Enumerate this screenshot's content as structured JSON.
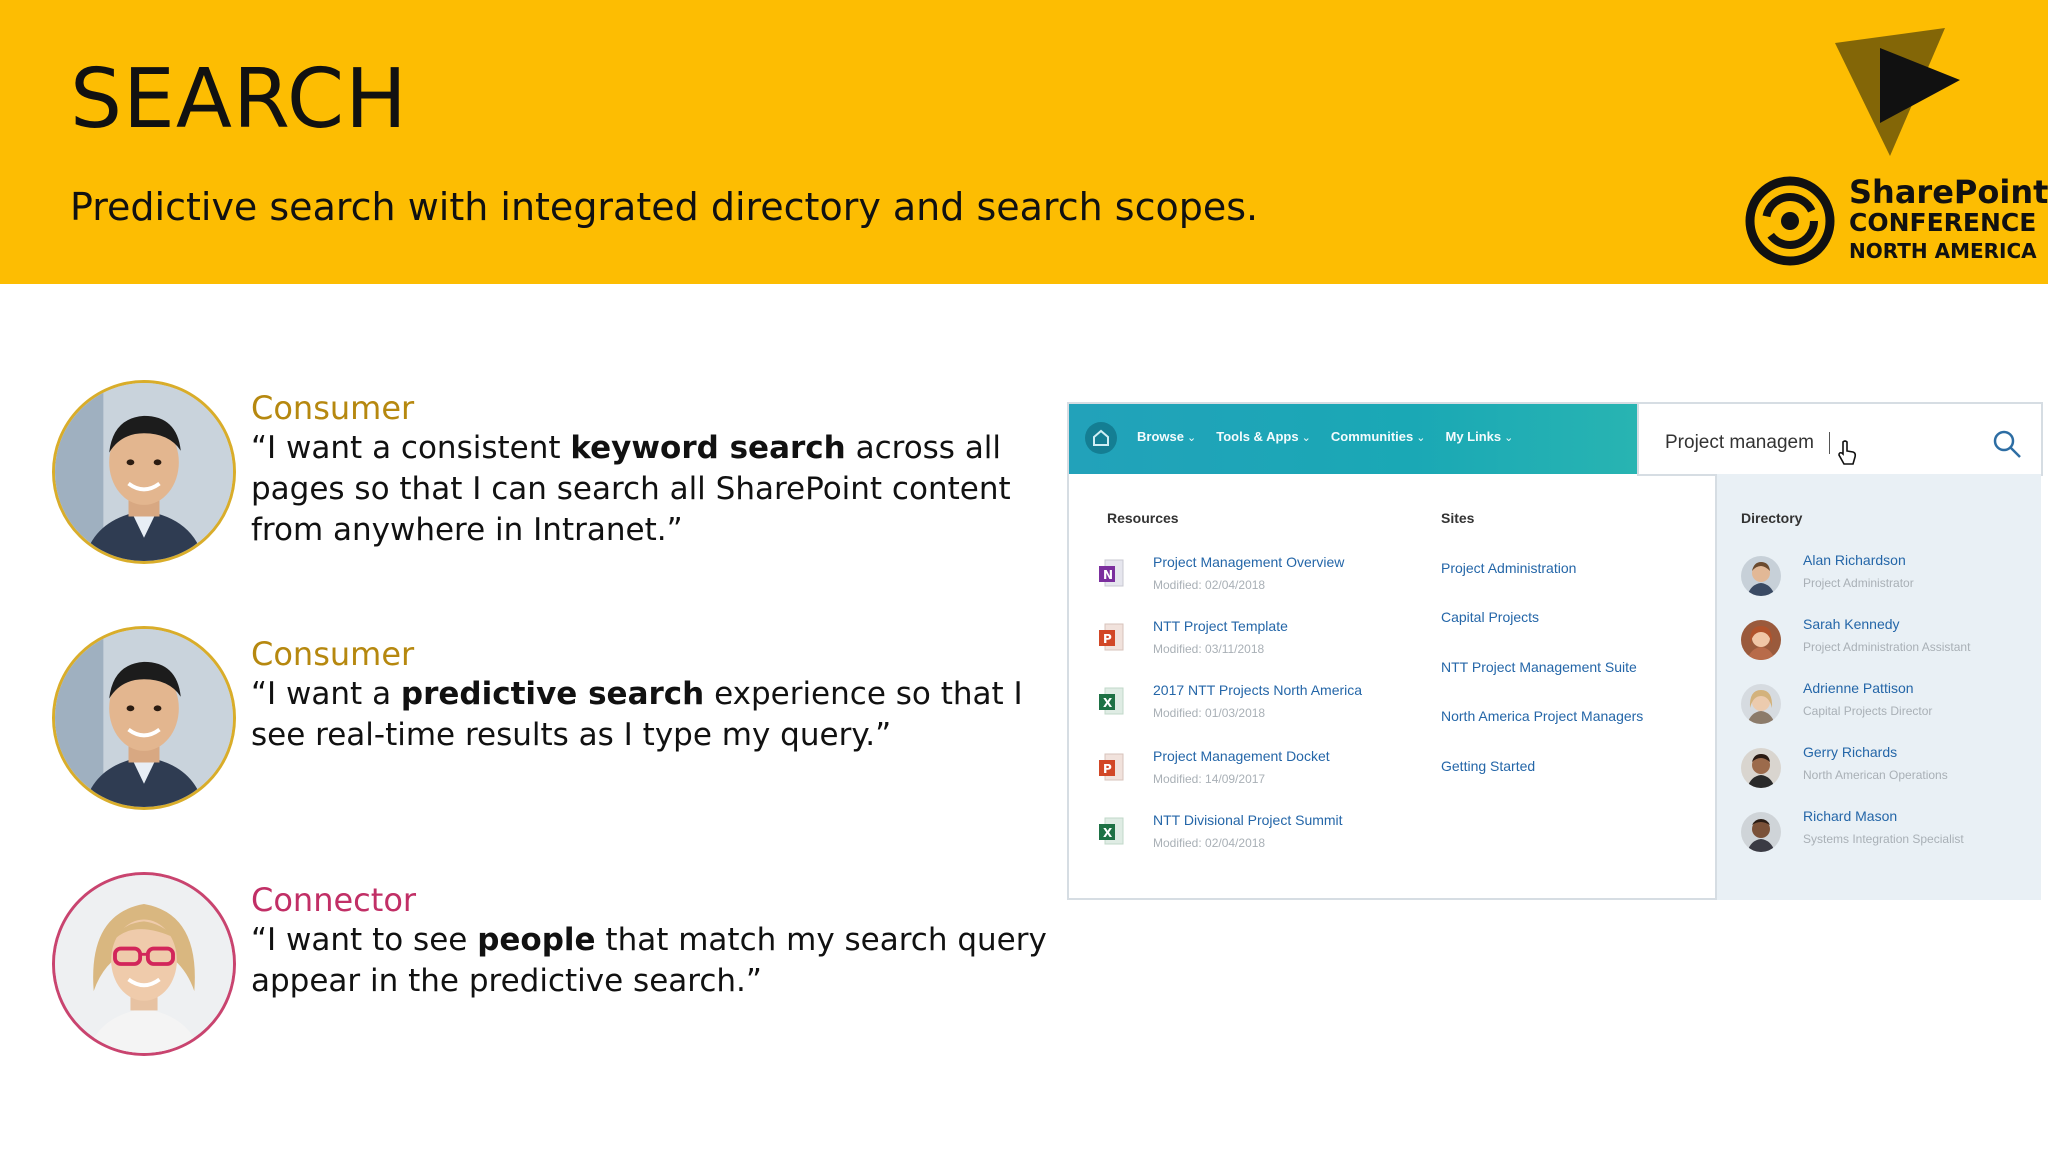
{
  "slide": {
    "title": "SEARCH",
    "subtitle": "Predictive search with integrated directory and search scopes."
  },
  "logo": {
    "line1": "SharePoint",
    "line2": "CONFERENCE",
    "line3": "NORTH AMERICA"
  },
  "personas": [
    {
      "role": "Consumer",
      "quote_pre": "“I want a consistent ",
      "quote_bold": "keyword search",
      "quote_post": " across all pages so that I can search all SharePoint content from anywhere in Intranet.”"
    },
    {
      "role": "Consumer",
      "quote_pre": "“I want a ",
      "quote_bold": "predictive search",
      "quote_post": " experience so that I see real-time results as I type my query.”"
    },
    {
      "role": "Connector",
      "quote_pre": "“I want to see ",
      "quote_bold": "people",
      "quote_post": " that match my search query appear in the predictive search.”"
    }
  ],
  "mock": {
    "nav": [
      "Browse",
      "Tools & Apps",
      "Communities",
      "My Links"
    ],
    "search_value": "Project managem",
    "resources_heading": "Resources",
    "sites_heading": "Sites",
    "directory_heading": "Directory",
    "resources": [
      {
        "title": "Project Management Overview",
        "meta": "Modified: 02/04/2018",
        "type": "onenote"
      },
      {
        "title": "NTT Project Template",
        "meta": "Modified: 03/11/2018",
        "type": "powerpoint"
      },
      {
        "title": "2017 NTT Projects North America",
        "meta": "Modified: 01/03/2018",
        "type": "excel"
      },
      {
        "title": "Project Management Docket",
        "meta": "Modified: 14/09/2017",
        "type": "powerpoint"
      },
      {
        "title": "NTT Divisional Project Summit",
        "meta": "Modified: 02/04/2018",
        "type": "excel"
      }
    ],
    "sites": [
      "Project Administration",
      "Capital Projects",
      "NTT Project Management Suite",
      "North America Project Managers",
      "Getting Started"
    ],
    "people": [
      {
        "name": "Alan Richardson",
        "role": "Project Administrator"
      },
      {
        "name": "Sarah Kennedy",
        "role": "Project Administration Assistant"
      },
      {
        "name": "Adrienne Pattison",
        "role": "Capital Projects Director"
      },
      {
        "name": "Gerry Richards",
        "role": "North American Operations"
      },
      {
        "name": "Richard Mason",
        "role": "Systems Integration Specialist"
      }
    ]
  },
  "colors": {
    "header_band": "#FDBD02",
    "consumer_role": "#b6880f",
    "connector_role": "#c12f66",
    "link_blue": "#2466a8",
    "nav_teal": "#22a2ba"
  }
}
